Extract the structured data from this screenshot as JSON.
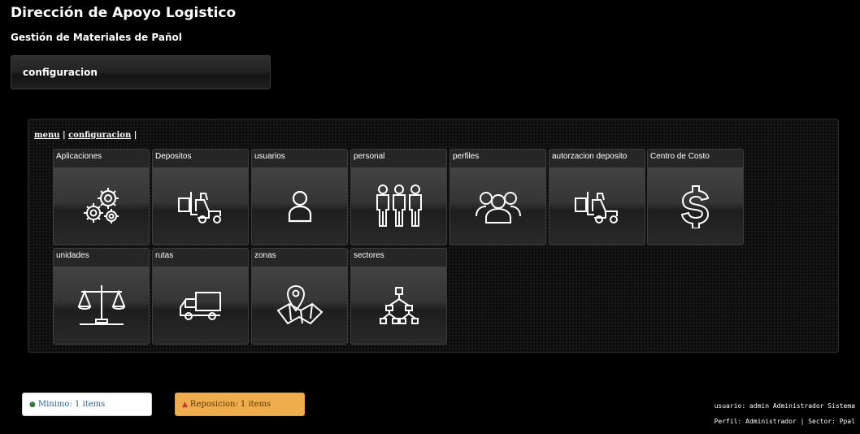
{
  "header": {
    "title": "Dirección de Apoyo Logistico",
    "subtitle": "Gestión de Materiales de Pañol"
  },
  "section": {
    "label": "configuracion"
  },
  "breadcrumb": {
    "menu": "menu",
    "separator": " | ",
    "current": "configuracion",
    "trailing": " |"
  },
  "tiles": [
    {
      "label": "Aplicaciones",
      "icon": "gears-icon"
    },
    {
      "label": "Depositos",
      "icon": "forklift-icon"
    },
    {
      "label": "usuarios",
      "icon": "user-icon"
    },
    {
      "label": "personal",
      "icon": "people-icon"
    },
    {
      "label": "perfiles",
      "icon": "group-icon"
    },
    {
      "label": "autorzacion deposito",
      "icon": "forklift-icon"
    },
    {
      "label": "Centro de Costo",
      "icon": "dollar-icon"
    },
    {
      "label": "unidades",
      "icon": "scale-icon"
    },
    {
      "label": "rutas",
      "icon": "truck-icon"
    },
    {
      "label": "zonas",
      "icon": "map-pin-icon"
    },
    {
      "label": "sectores",
      "icon": "hierarchy-icon"
    }
  ],
  "alerts": {
    "minimo": "Minimo: 1 items",
    "reposicion": "Reposicion: 1 items"
  },
  "user": {
    "line1": "usuario: admin Administrador Sistema",
    "line2": "Perfil: Administrador | Sector: Ppal"
  }
}
